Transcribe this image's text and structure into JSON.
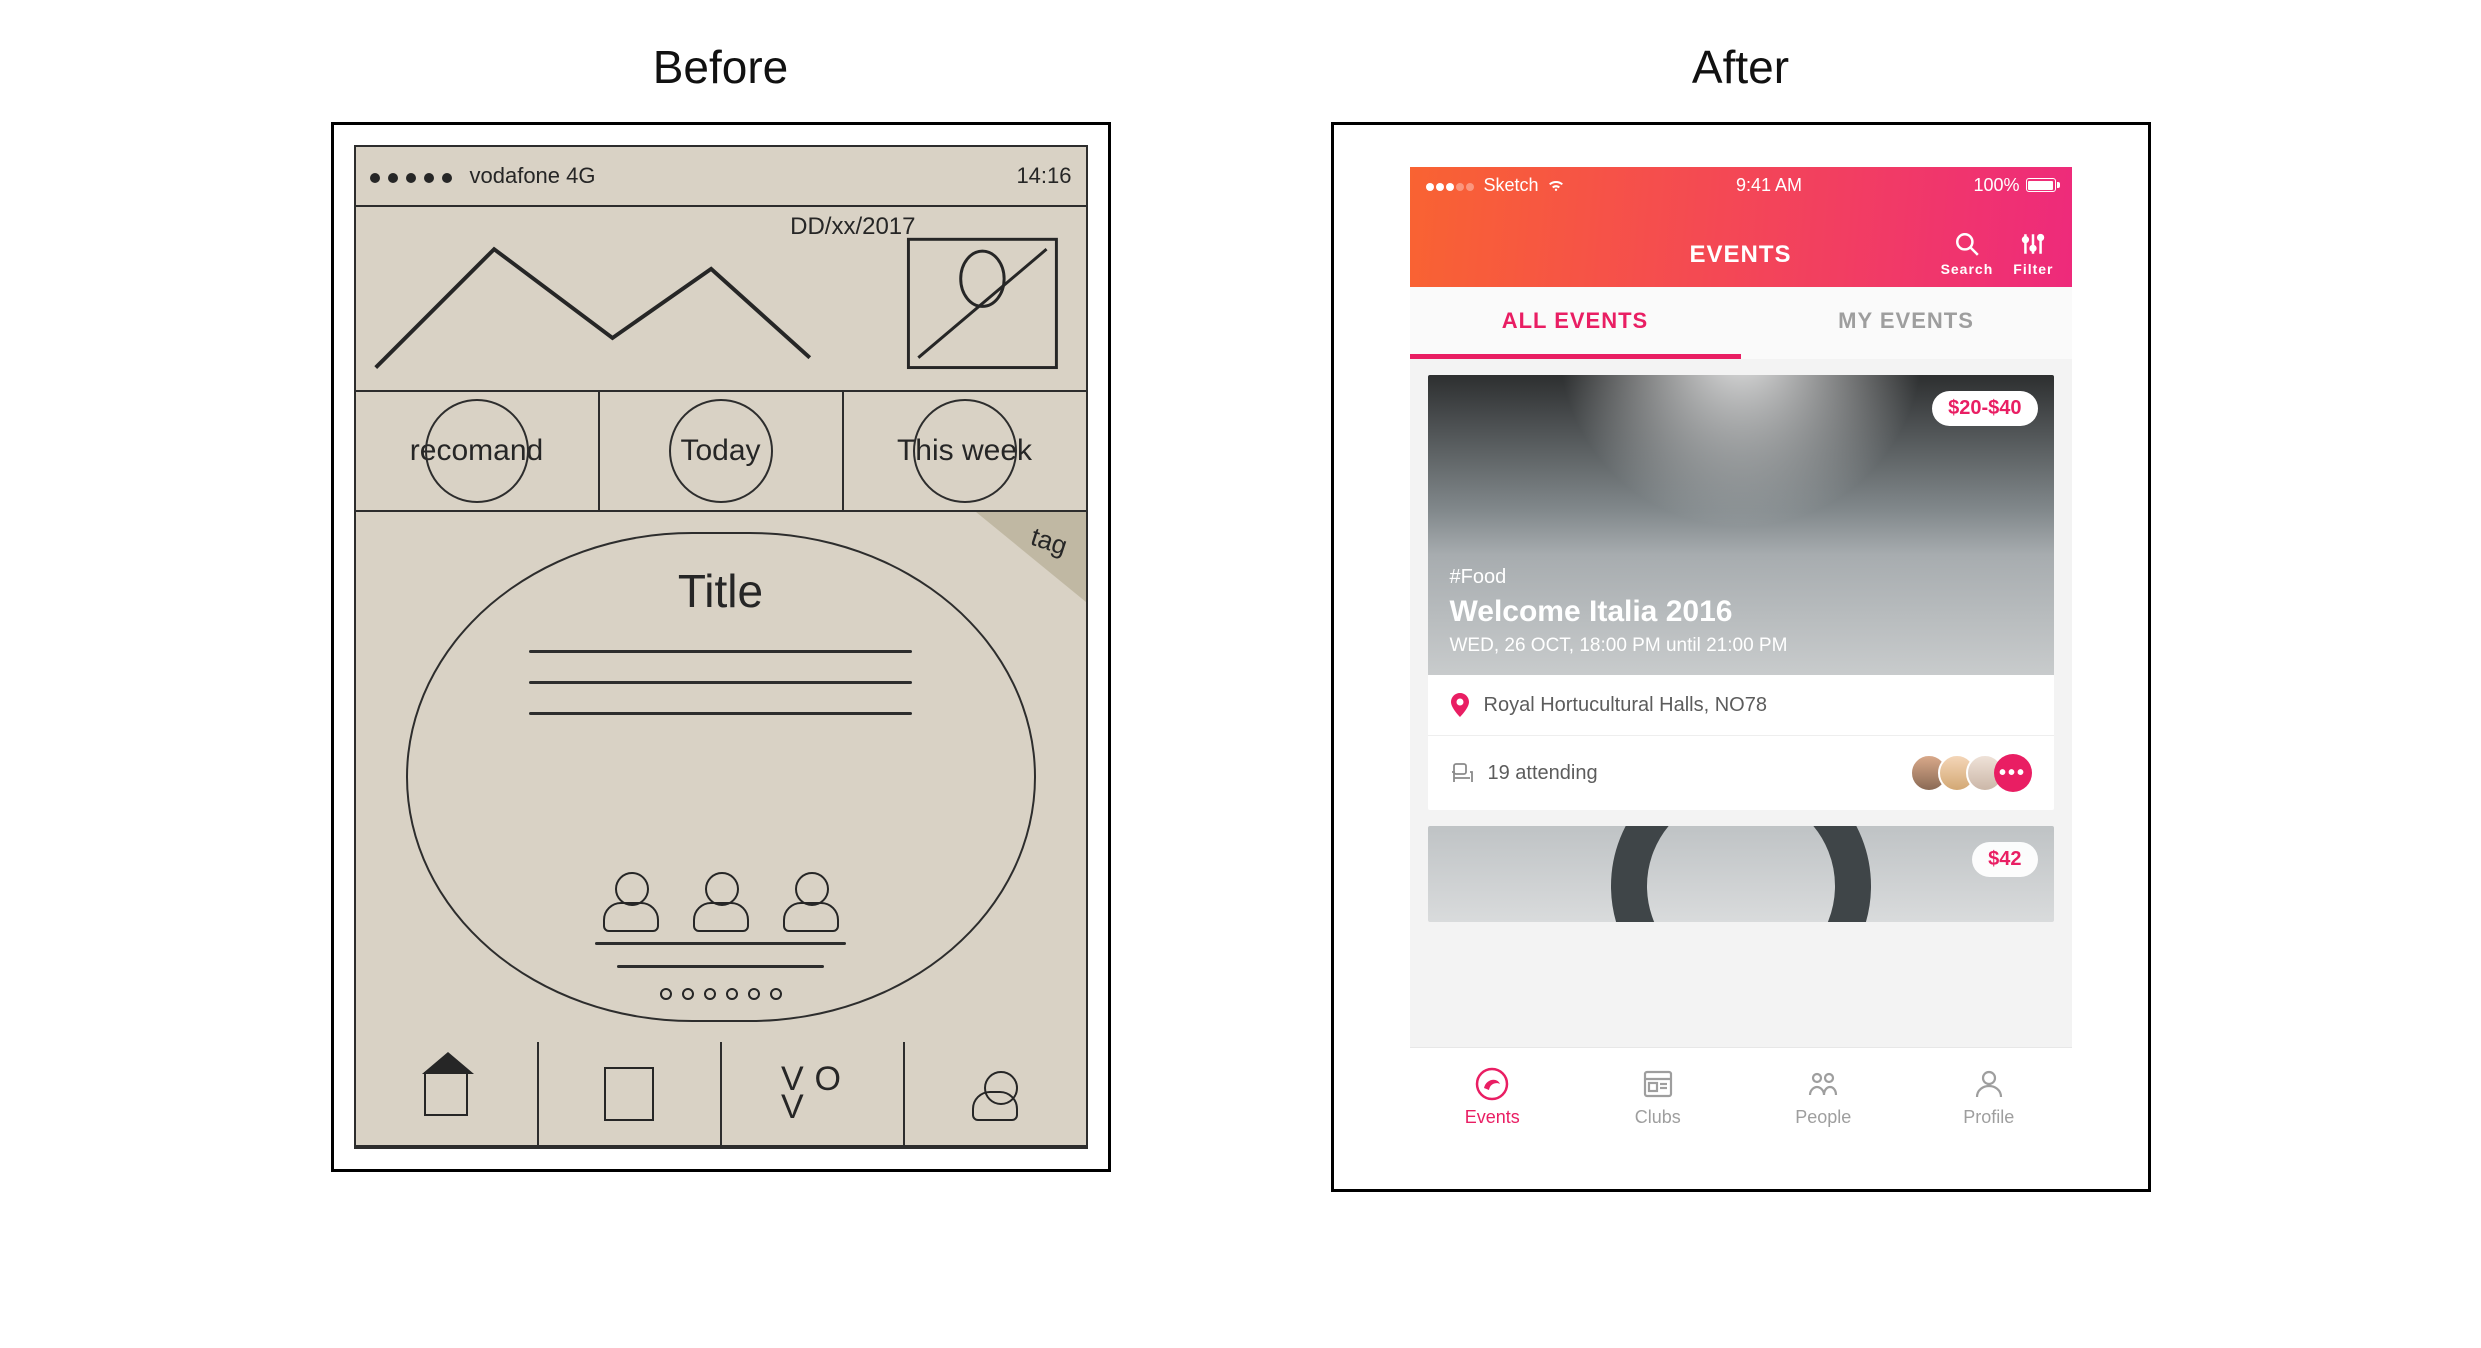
{
  "labels": {
    "before": "Before",
    "after": "After"
  },
  "sketch": {
    "status": {
      "carrier": "vodafone 4G",
      "time": "14:16"
    },
    "date": "DD/xx/2017",
    "tabs": [
      "recomand",
      "Today",
      "This week"
    ],
    "card": {
      "tag": "tag",
      "title": "Title"
    }
  },
  "app": {
    "status": {
      "carrier": "Sketch",
      "time": "9:41 AM",
      "battery": "100%"
    },
    "header": {
      "title": "EVENTS",
      "search_label": "Search",
      "filter_label": "Filter"
    },
    "tabs": {
      "all": "ALL EVENTS",
      "mine": "MY EVENTS"
    },
    "event1": {
      "price": "$20-$40",
      "tag": "#Food",
      "title": "Welcome Italia 2016",
      "subtitle": "WED, 26 OCT, 18:00 PM until 21:00 PM",
      "location": "Royal Hortucultural Halls, NO78",
      "attending": "19 attending",
      "more": "•••"
    },
    "event2": {
      "price": "$42"
    },
    "tabbar": {
      "events": "Events",
      "clubs": "Clubs",
      "people": "People",
      "profile": "Profile"
    }
  }
}
